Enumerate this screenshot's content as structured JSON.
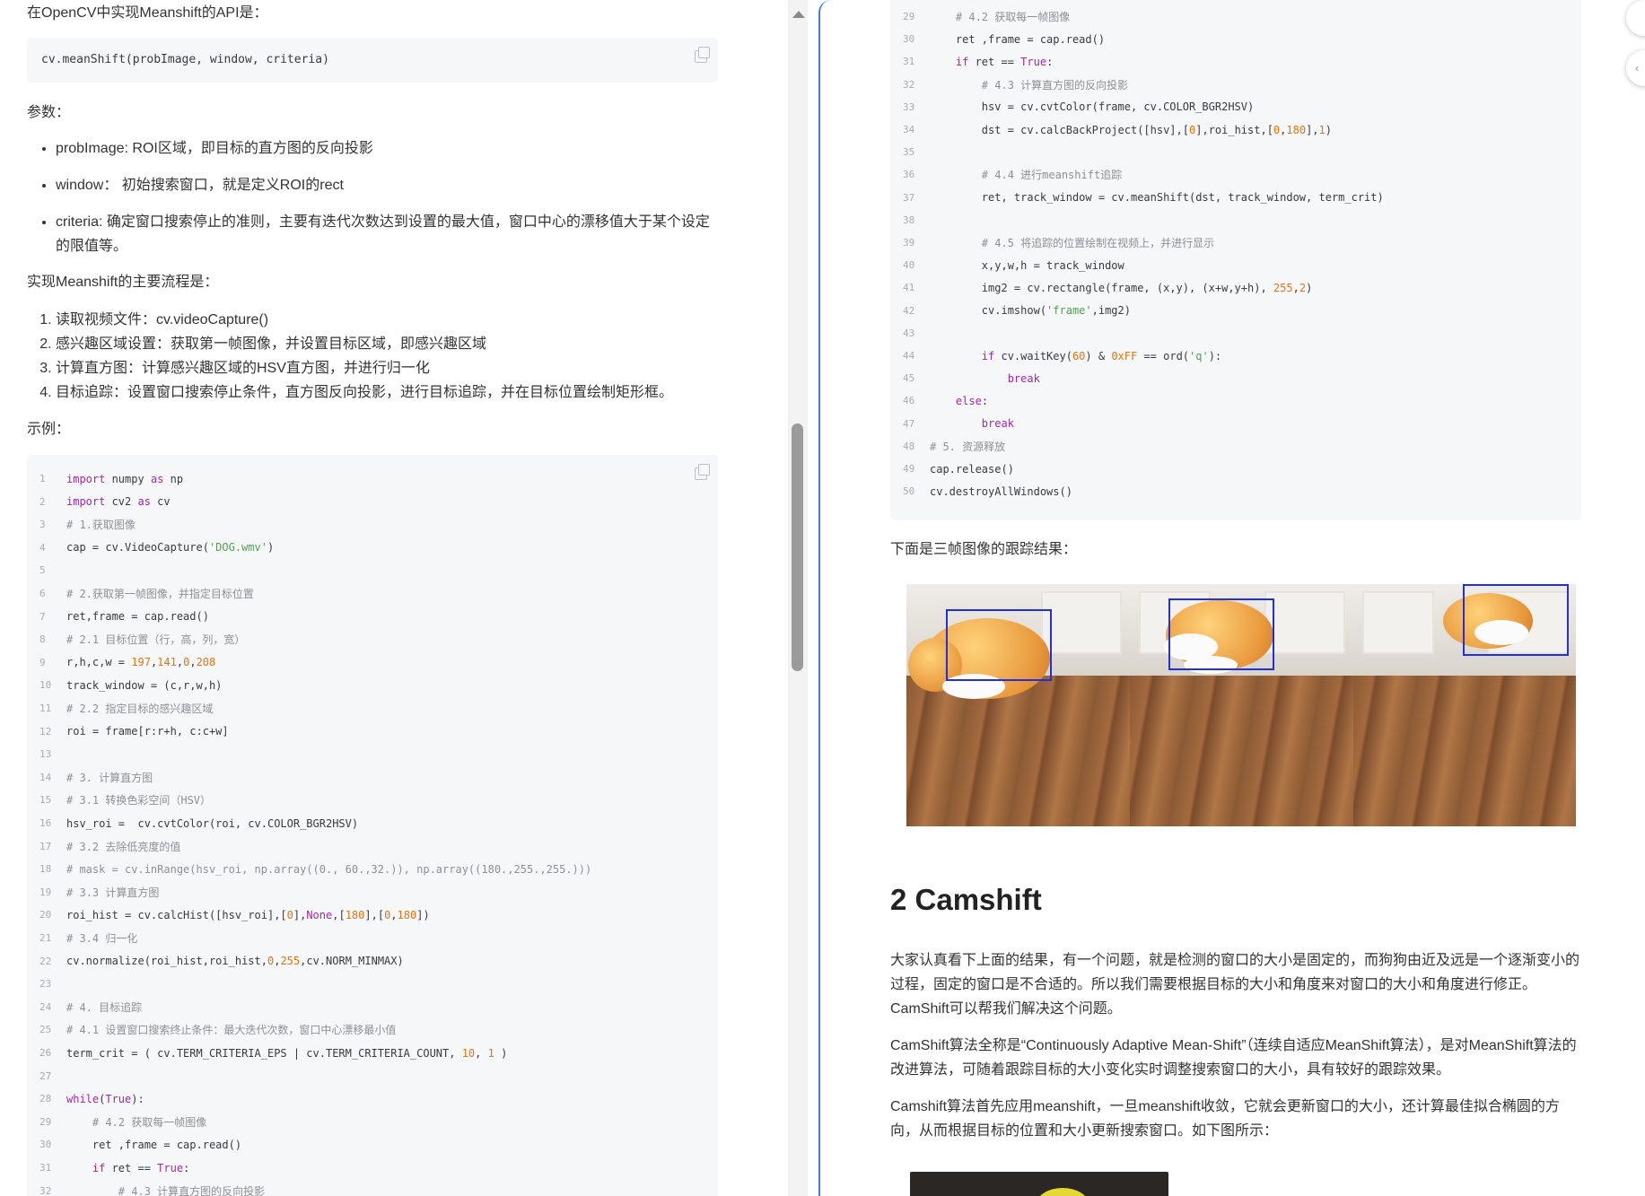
{
  "left": {
    "intro_text": "在OpenCV中实现Meanshift的API是：",
    "api_code": "cv.meanShift(probImage, window, criteria)",
    "params_heading": "参数：",
    "params": [
      "probImage: ROI区域，即目标的直方图的反向投影",
      "window： 初始搜索窗口，就是定义ROI的rect",
      "criteria: 确定窗口搜索停止的准则，主要有迭代次数达到设置的最大值，窗口中心的漂移值大于某个设定的限值等。"
    ],
    "flow_heading": "实现Meanshift的主要流程是：",
    "flow_steps": [
      "读取视频文件：cv.videoCapture()",
      "感兴趣区域设置：获取第一帧图像，并设置目标区域，即感兴趣区域",
      "计算直方图：计算感兴趣区域的HSV直方图，并进行归一化",
      "目标追踪：设置窗口搜索停止条件，直方图反向投影，进行目标追踪，并在目标位置绘制矩形框。"
    ],
    "example_heading": "示例：",
    "code_lines": [
      {
        "n": "1",
        "t": "import numpy as np"
      },
      {
        "n": "2",
        "t": "import cv2 as cv"
      },
      {
        "n": "3",
        "t": "# 1.获取图像"
      },
      {
        "n": "4",
        "t": "cap = cv.VideoCapture('DOG.wmv')"
      },
      {
        "n": "5",
        "t": ""
      },
      {
        "n": "6",
        "t": "# 2.获取第一帧图像，并指定目标位置"
      },
      {
        "n": "7",
        "t": "ret,frame = cap.read()"
      },
      {
        "n": "8",
        "t": "# 2.1 目标位置（行，高，列，宽）"
      },
      {
        "n": "9",
        "t": "r,h,c,w = 197,141,0,208"
      },
      {
        "n": "10",
        "t": "track_window = (c,r,w,h)"
      },
      {
        "n": "11",
        "t": "# 2.2 指定目标的感兴趣区域"
      },
      {
        "n": "12",
        "t": "roi = frame[r:r+h, c:c+w]"
      },
      {
        "n": "13",
        "t": ""
      },
      {
        "n": "14",
        "t": "# 3. 计算直方图"
      },
      {
        "n": "15",
        "t": "# 3.1 转换色彩空间（HSV）"
      },
      {
        "n": "16",
        "t": "hsv_roi =  cv.cvtColor(roi, cv.COLOR_BGR2HSV)"
      },
      {
        "n": "17",
        "t": "# 3.2 去除低亮度的值"
      },
      {
        "n": "18",
        "t": "# mask = cv.inRange(hsv_roi, np.array((0., 60.,32.)), np.array((180.,255.,255.)))"
      },
      {
        "n": "19",
        "t": "# 3.3 计算直方图"
      },
      {
        "n": "20",
        "t": "roi_hist = cv.calcHist([hsv_roi],[0],None,[180],[0,180])"
      },
      {
        "n": "21",
        "t": "# 3.4 归一化"
      },
      {
        "n": "22",
        "t": "cv.normalize(roi_hist,roi_hist,0,255,cv.NORM_MINMAX)"
      },
      {
        "n": "23",
        "t": ""
      },
      {
        "n": "24",
        "t": "# 4. 目标追踪"
      },
      {
        "n": "25",
        "t": "# 4.1 设置窗口搜索终止条件：最大迭代次数，窗口中心漂移最小值"
      },
      {
        "n": "26",
        "t": "term_crit = ( cv.TERM_CRITERIA_EPS | cv.TERM_CRITERIA_COUNT, 10, 1 )"
      },
      {
        "n": "27",
        "t": ""
      },
      {
        "n": "28",
        "t": "while(True):"
      },
      {
        "n": "29",
        "t": "    # 4.2 获取每一帧图像"
      },
      {
        "n": "30",
        "t": "    ret ,frame = cap.read()"
      },
      {
        "n": "31",
        "t": "    if ret == True:"
      },
      {
        "n": "32",
        "t": "        # 4.3 计算直方图的反向投影"
      }
    ]
  },
  "right": {
    "code_lines": [
      {
        "n": "29",
        "t": "    # 4.2 获取每一帧图像"
      },
      {
        "n": "30",
        "t": "    ret ,frame = cap.read()"
      },
      {
        "n": "31",
        "t": "    if ret == True:"
      },
      {
        "n": "32",
        "t": "        # 4.3 计算直方图的反向投影"
      },
      {
        "n": "33",
        "t": "        hsv = cv.cvtColor(frame, cv.COLOR_BGR2HSV)"
      },
      {
        "n": "34",
        "t": "        dst = cv.calcBackProject([hsv],[0],roi_hist,[0,180],1)"
      },
      {
        "n": "35",
        "t": ""
      },
      {
        "n": "36",
        "t": "        # 4.4 进行meanshift追踪"
      },
      {
        "n": "37",
        "t": "        ret, track_window = cv.meanShift(dst, track_window, term_crit)"
      },
      {
        "n": "38",
        "t": ""
      },
      {
        "n": "39",
        "t": "        # 4.5 将追踪的位置绘制在视频上，并进行显示"
      },
      {
        "n": "40",
        "t": "        x,y,w,h = track_window"
      },
      {
        "n": "41",
        "t": "        img2 = cv.rectangle(frame, (x,y), (x+w,y+h), 255,2)"
      },
      {
        "n": "42",
        "t": "        cv.imshow('frame',img2)"
      },
      {
        "n": "43",
        "t": ""
      },
      {
        "n": "44",
        "t": "        if cv.waitKey(60) & 0xFF == ord('q'):"
      },
      {
        "n": "45",
        "t": "            break"
      },
      {
        "n": "46",
        "t": "    else:"
      },
      {
        "n": "47",
        "t": "        break"
      },
      {
        "n": "48",
        "t": "# 5. 资源释放"
      },
      {
        "n": "49",
        "t": "cap.release()"
      },
      {
        "n": "50",
        "t": "cv.destroyAllWindows()"
      }
    ],
    "tracking_caption": "下面是三帧图像的跟踪结果：",
    "section_heading": "2 Camshift",
    "paragraphs": [
      "大家认真看下上面的结果，有一个问题，就是检测的窗口的大小是固定的，而狗狗由近及远是一个逐渐变小的过程，固定的窗口是不合适的。所以我们需要根据目标的大小和角度来对窗口的大小和角度进行修正。CamShift可以帮我们解决这个问题。",
      "CamShift算法全称是“Continuously Adaptive Mean-Shift”（连续自适应MeanShift算法），是对MeanShift算法的改进算法，可随着跟踪目标的大小变化实时调整搜索窗口的大小，具有较好的跟踪效果。",
      "Camshift算法首先应用meanshift，一旦meanshift收敛，它就会更新窗口的大小，还计算最佳拟合椭圆的方向，从而根据目标的位置和大小更新搜索窗口。如下图所示："
    ]
  },
  "colors": {
    "accent": "#3b7de9",
    "code_bg": "#f6f7f9",
    "keyword": "#a626a4",
    "string": "#50a14f",
    "number": "#e8730c",
    "comment": "#8c9096",
    "track_box": "#2230d8"
  }
}
